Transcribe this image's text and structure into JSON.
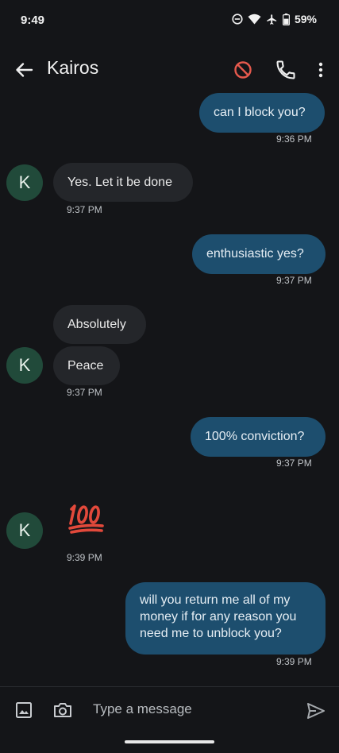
{
  "status_bar": {
    "time": "9:49",
    "battery": "59%"
  },
  "header": {
    "contact_name": "Kairos"
  },
  "avatar_letter": "K",
  "messages": [
    {
      "text": "can I block you?",
      "time": "9:36 PM"
    },
    {
      "text": "Yes. Let it be done",
      "time": "9:37 PM"
    },
    {
      "text": "enthusiastic yes?",
      "time": "9:37 PM"
    },
    {
      "text": "Absolutely"
    },
    {
      "text": "Peace",
      "time": "9:37 PM"
    },
    {
      "text": "100% conviction?",
      "time": "9:37 PM"
    },
    {
      "emoji": "💯",
      "time": "9:39 PM"
    },
    {
      "text": "will you return me all of my money if for any reason you need me to unblock you?",
      "time": "9:39 PM"
    }
  ],
  "composer": {
    "placeholder": "Type a message"
  },
  "colors": {
    "outgoing_bubble": "#1d4e6e",
    "incoming_bubble": "#24262a",
    "avatar": "#214a3a",
    "block_icon": "#e5594d"
  }
}
